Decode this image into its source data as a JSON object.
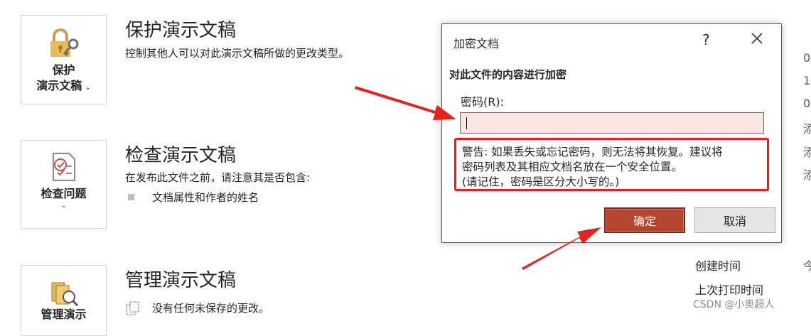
{
  "sections": [
    {
      "tile_line1": "保护",
      "tile_line2": "演示文稿",
      "title": "保护演示文稿",
      "desc": "控制其他人可以对此演示文稿所做的更改类型。"
    },
    {
      "tile_line1": "检查问题",
      "title": "检查演示文稿",
      "desc": "在发布此文件之前，请注意其是否包含:",
      "bullet": "文档属性和作者的姓名"
    },
    {
      "tile_line1": "管理演示",
      "title": "管理演示文稿",
      "desc": "没有任何未保存的更改。"
    }
  ],
  "properties": {
    "created": "创建时间",
    "last_printed": "上次打印时间"
  },
  "edge_values": [
    "0",
    "1",
    "0",
    "添",
    "添",
    "添",
    "今"
  ],
  "dialog": {
    "title": "加密文档",
    "help": "?",
    "heading": "对此文件的内容进行加密",
    "password_label": "密码(R):",
    "password_value": "",
    "warning_lines": [
      "警告: 如果丢失或忘记密码，则无法将其恢复。建议将",
      "密码列表及其相应文档名放在一个安全位置。",
      "(请记住，密码是区分大小写的。)"
    ],
    "ok_label": "确定",
    "cancel_label": "取消"
  },
  "watermark": "CSDN @小奥超人",
  "colors": {
    "accent": "#b5452e",
    "highlight": "#e8211d",
    "input_bg": "#fbe5e0"
  }
}
